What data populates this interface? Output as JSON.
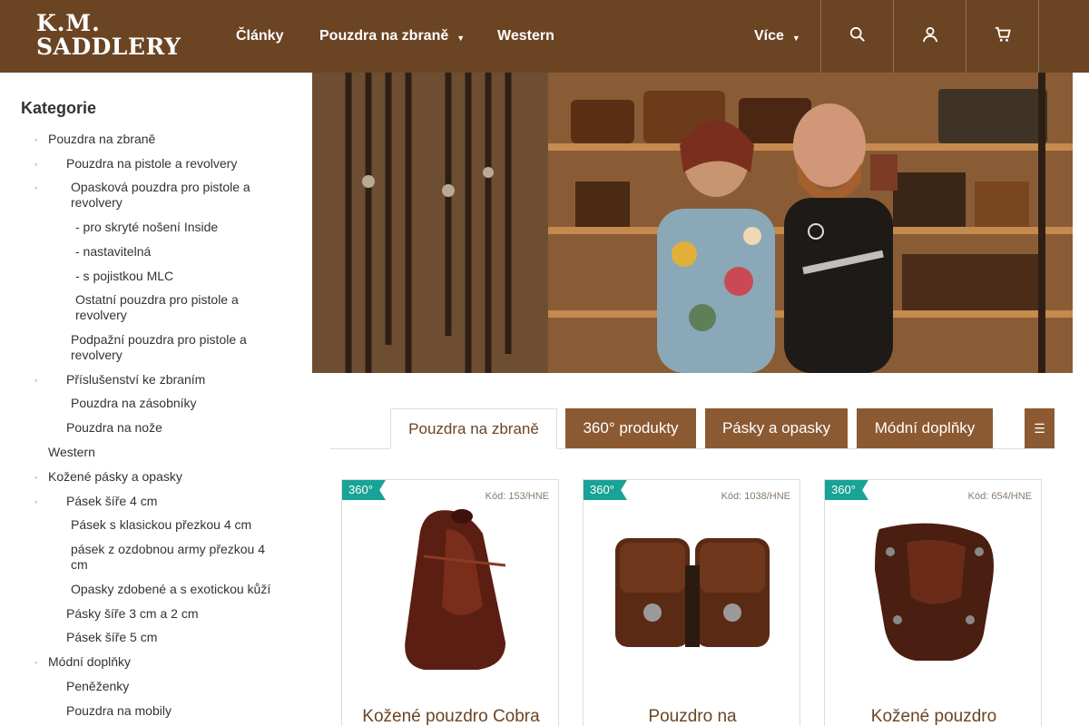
{
  "header": {
    "logo_line1": "K.M.",
    "logo_line2": "SADDLERY",
    "nav": [
      "Články",
      "Pouzdra na zbraně",
      "Western"
    ],
    "more_label": "Více",
    "icons": [
      "search-icon",
      "user-icon",
      "cart-icon"
    ]
  },
  "sidebar": {
    "title": "Kategorie",
    "items": [
      "Pouzdra na zbraně",
      "Pouzdra na pistole a revolvery",
      "Opasková pouzdra pro pistole a revolvery",
      "- pro skryté nošení Inside",
      "- nastavitelná",
      "- s pojistkou MLC",
      "Ostatní pouzdra pro pistole a revolvery",
      "Podpažní pouzdra pro pistole a revolvery",
      "Příslušenství ke zbraním",
      "Pouzdra na zásobníky",
      "Pouzdra na nože",
      "Western",
      "Kožené pásky a opasky",
      "Pásek šíře 4 cm",
      "Pásek s klasickou přezkou 4 cm",
      "pásek z ozdobnou army přezkou 4 cm",
      "Opasky zdobené a s exotickou kůží",
      "Pásky šíře 3 cm a 2 cm",
      "Pásek šíře 5 cm",
      "Módní doplňky",
      "Peněženky",
      "Pouzdra na mobily"
    ]
  },
  "tabs": {
    "items": [
      "Pouzdra na zbraně",
      "360° produkty",
      "Pásky a opasky",
      "Módní doplňky"
    ],
    "active_index": 0,
    "menu_icon": "☰"
  },
  "products": [
    {
      "badge": "360°",
      "code": "Kód: 153/HNE",
      "title": "Kožené pouzdro Cobra"
    },
    {
      "badge": "360°",
      "code": "Kód: 1038/HNE",
      "title": "Pouzdro na"
    },
    {
      "badge": "360°",
      "code": "Kód: 654/HNE",
      "title": "Kožené pouzdro"
    }
  ],
  "colors": {
    "header_bg": "#6b4423",
    "tab_bg": "#8b5a33",
    "badge_bg": "#18a396",
    "accent_text": "#6b4423"
  }
}
